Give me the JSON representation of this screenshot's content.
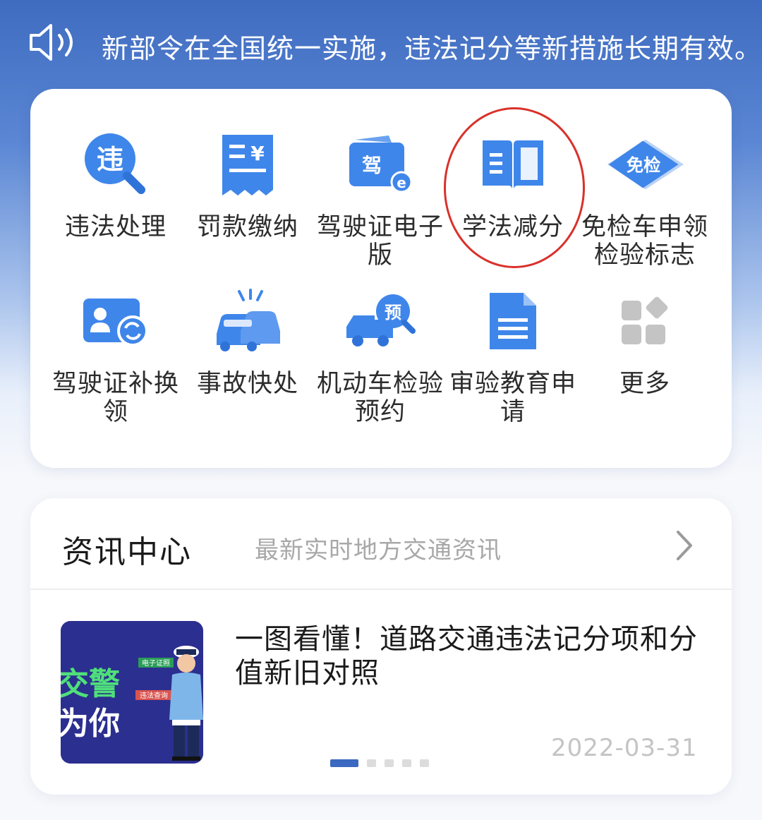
{
  "notice": {
    "text": "新部令在全国统一实施，违法记分等新措施长期有效。",
    "icon": "speaker-icon"
  },
  "services": [
    {
      "label": "违法处理",
      "icon": "violation-search-icon"
    },
    {
      "label": "罚款缴纳",
      "icon": "fine-receipt-icon"
    },
    {
      "label": "驾驶证电子版",
      "icon": "e-license-icon"
    },
    {
      "label": "学法减分",
      "icon": "open-book-icon"
    },
    {
      "label": "免检车申领检验标志",
      "icon": "inspection-exempt-icon"
    },
    {
      "label": "驾驶证补换领",
      "icon": "license-renew-icon"
    },
    {
      "label": "事故快处",
      "icon": "car-accident-icon"
    },
    {
      "label": "机动车检验预约",
      "icon": "vehicle-booking-icon"
    },
    {
      "label": "审验教育申请",
      "icon": "document-icon"
    },
    {
      "label": "更多",
      "icon": "more-grid-icon"
    }
  ],
  "news": {
    "title": "资讯中心",
    "subtitle": "最新实时地方交通资讯",
    "article_title": "一图看懂！道路交通违法记分项和分值新旧对照",
    "date": "2022-03-31",
    "thumbnail_text": {
      "line1": "交警",
      "line2": "为你",
      "tag1": "电子证照",
      "tag2": "违法查询"
    },
    "carousel_pages": 5,
    "carousel_active": 1
  },
  "colors": {
    "accent": "#3b7be8",
    "highlight_circle": "#d9312b",
    "header_bg": "#3f6cc0"
  }
}
